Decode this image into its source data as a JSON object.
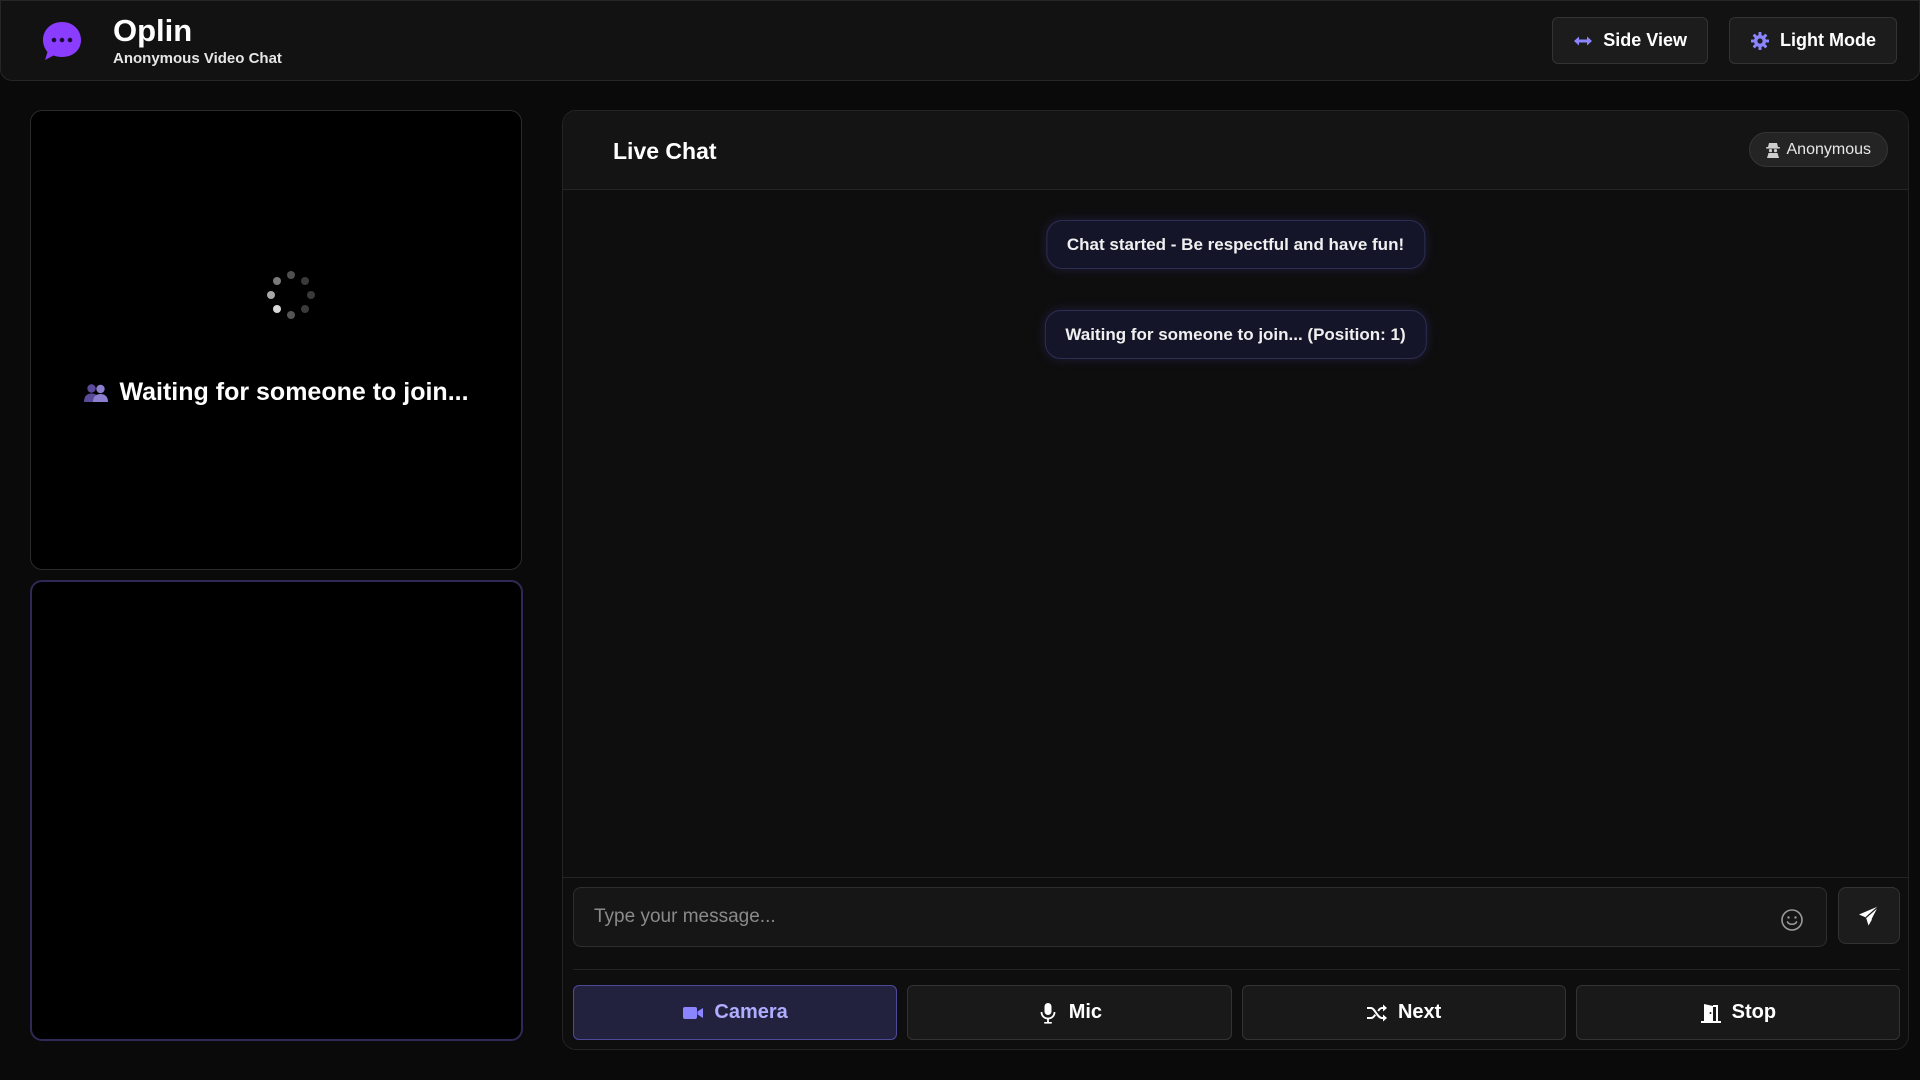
{
  "header": {
    "title": "Oplin",
    "subtitle": "Anonymous Video Chat",
    "side_view_label": "Side View",
    "light_mode_label": "Light Mode"
  },
  "remote_video": {
    "status_text": "Waiting for someone to join..."
  },
  "chat": {
    "title": "Live Chat",
    "badge": "Anonymous",
    "messages": [
      "Chat started - Be respectful and have fun!",
      "Waiting for someone to join... (Position: 1)"
    ],
    "input_placeholder": "Type your message..."
  },
  "controls": {
    "camera": "Camera",
    "mic": "Mic",
    "next": "Next",
    "stop": "Stop",
    "active": "camera"
  },
  "colors": {
    "accent": "#8b85ff",
    "logo": "#8b3dff",
    "background": "#0a0a0a",
    "panel": "#0e0e0e"
  },
  "icons": {
    "logo": "chat-bubble-icon",
    "side_view": "arrows-horizontal-icon",
    "light_mode": "gear-icon",
    "badge": "user-secret-icon",
    "waiting": "users-icon",
    "emoji": "smiley-icon",
    "send": "paper-plane-icon",
    "camera": "video-camera-icon",
    "mic": "microphone-icon",
    "next": "shuffle-icon",
    "stop": "door-exit-icon"
  }
}
